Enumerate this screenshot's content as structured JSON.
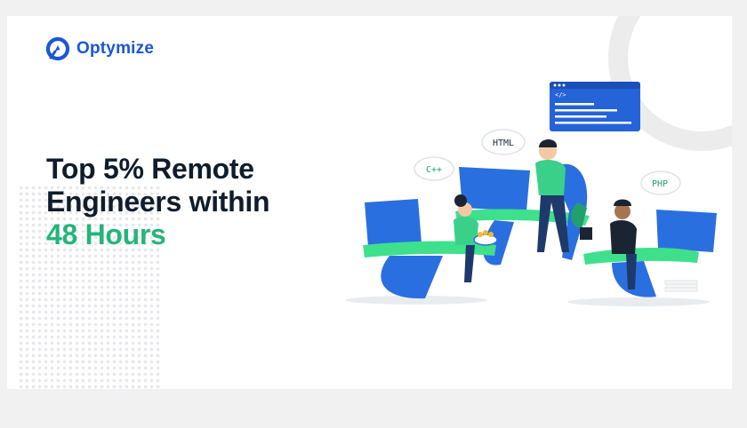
{
  "brand": {
    "name": "Optymize",
    "icon": "optymize-logo-icon"
  },
  "headline": {
    "line1": "Top 5% Remote",
    "line2": "Engineers within",
    "line3": "48 Hours"
  },
  "illustration": {
    "bubbles": {
      "cpp": "C++",
      "html": "HTML",
      "php": "PHP"
    },
    "code_window_tag": "</>"
  },
  "colors": {
    "brand_blue": "#1b56d6",
    "accent_green": "#25b57a",
    "desk_green": "#3ee08c",
    "monitor_blue": "#2a6fe0"
  }
}
